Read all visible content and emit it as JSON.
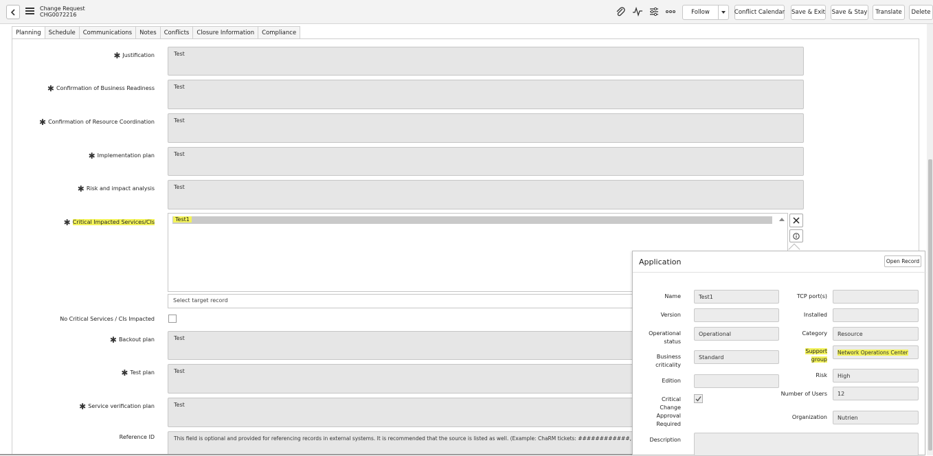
{
  "header": {
    "title": "Change Request",
    "number": "CHG0072216",
    "buttons": {
      "follow": "Follow",
      "conflict_calendar": "Conflict Calendar",
      "save_exit": "Save & Exit",
      "save_stay": "Save & Stay",
      "translate": "Translate",
      "delete": "Delete"
    },
    "icons": [
      "back-icon",
      "hamburger-menu-icon",
      "paperclip-icon",
      "activity-icon",
      "settings-sliders-icon",
      "more-icon",
      "chevron-down-icon"
    ]
  },
  "tabs": [
    "Planning",
    "Schedule",
    "Communications",
    "Notes",
    "Conflicts",
    "Closure Information",
    "Compliance"
  ],
  "form": {
    "justification": {
      "label": "Justification",
      "value": "Test"
    },
    "business_readiness": {
      "label": "Confirmation of Business Readiness",
      "value": "Test"
    },
    "resource_coordination": {
      "label": "Confirmation of Resource Coordination",
      "value": "Test"
    },
    "implementation_plan": {
      "label": "Implementation plan",
      "value": "Test"
    },
    "risk_impact": {
      "label": "Risk and impact analysis",
      "value": "Test"
    },
    "critical_services": {
      "label": "Critical Impacted Services/CIs",
      "item": "Test1"
    },
    "select_target_placeholder": "Select target record",
    "no_critical": {
      "label": "No Critical Services / CIs Impacted"
    },
    "backout_plan": {
      "label": "Backout plan",
      "value": "Test"
    },
    "test_plan": {
      "label": "Test plan",
      "value": "Test"
    },
    "service_verification": {
      "label": "Service verification plan",
      "value": "Test"
    },
    "reference_id": {
      "label": "Reference ID",
      "value": "This field is optional and provided for referencing records in external systems. It is recommended that the source is listed as well. (Example: ChaRM tickets: ############, ############)"
    }
  },
  "popup": {
    "title": "Application",
    "open_record": "Open Record",
    "left": [
      {
        "label": "Name",
        "value": "Test1"
      },
      {
        "label": "Version",
        "value": ""
      },
      {
        "label": "Operational status",
        "value": "Operational"
      },
      {
        "label": "Business criticality",
        "value": "Standard"
      },
      {
        "label": "Edition",
        "value": ""
      },
      {
        "label": "Critical Change Approval Required",
        "value": "checked"
      },
      {
        "label": "Description",
        "value": ""
      }
    ],
    "right": [
      {
        "label": "TCP port(s)",
        "value": ""
      },
      {
        "label": "Installed",
        "value": ""
      },
      {
        "label": "Category",
        "value": "Resource"
      },
      {
        "label": "Support group",
        "value": "Network Operations Center"
      },
      {
        "label": "Risk",
        "value": "High"
      },
      {
        "label": "Number of Users",
        "value": "12"
      },
      {
        "label": "Organization",
        "value": "Nutrien"
      }
    ]
  },
  "colors": {
    "highlight": "#f3f35a",
    "field_bg": "#e6e6e6",
    "header_bg": "#f3f3f3"
  }
}
